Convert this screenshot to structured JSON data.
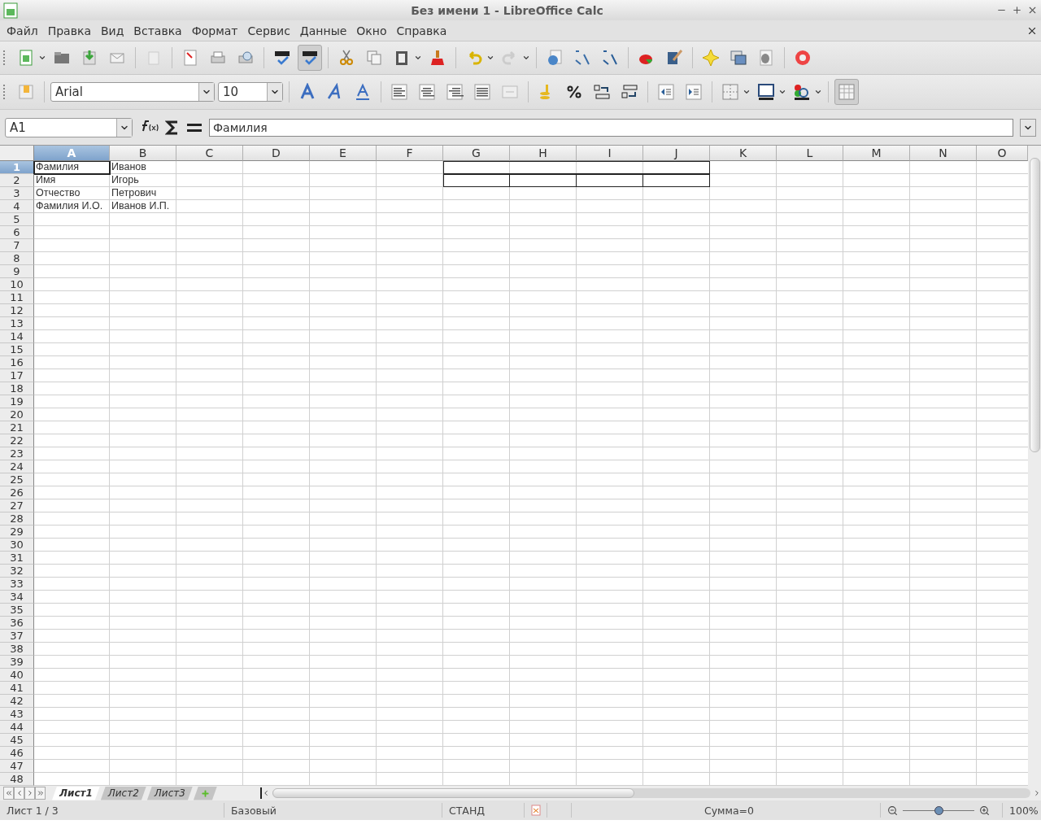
{
  "window": {
    "title": "Без имени 1 - LibreOffice Calc"
  },
  "menu": [
    {
      "label": "Файл"
    },
    {
      "label": "Правка"
    },
    {
      "label": "Вид"
    },
    {
      "label": "Вставка"
    },
    {
      "label": "Формат"
    },
    {
      "label": "Сервис"
    },
    {
      "label": "Данные"
    },
    {
      "label": "Окно"
    },
    {
      "label": "Справка"
    }
  ],
  "formatting": {
    "font_name": "Arial",
    "font_size": "10"
  },
  "formula_bar": {
    "name_box": "A1",
    "formula": "Фамилия"
  },
  "columns": [
    {
      "label": "A",
      "selected": true
    },
    {
      "label": "B",
      "selected": false
    },
    {
      "label": "C",
      "selected": false
    },
    {
      "label": "D",
      "selected": false
    },
    {
      "label": "E",
      "selected": false
    },
    {
      "label": "F",
      "selected": false
    },
    {
      "label": "G",
      "selected": false
    },
    {
      "label": "H",
      "selected": false
    },
    {
      "label": "I",
      "selected": false
    },
    {
      "label": "J",
      "selected": false
    },
    {
      "label": "K",
      "selected": false
    },
    {
      "label": "L",
      "selected": false
    },
    {
      "label": "M",
      "selected": false
    },
    {
      "label": "N",
      "selected": false
    },
    {
      "label": "O",
      "selected": false
    }
  ],
  "rows": [
    {
      "header": "1",
      "selected": true,
      "cells": [
        {
          "text": "Фамилия",
          "selected": true
        },
        {
          "text": "Иванов",
          "selected": false
        },
        {},
        {},
        {},
        {},
        {
          "kind": "outer-border"
        },
        {
          "kind": "outer-border"
        },
        {
          "kind": "outer-border"
        },
        {
          "kind": "outer-border"
        }
      ]
    },
    {
      "header": "2",
      "selected": false,
      "cells": [
        {
          "text": "Имя",
          "selected": false
        },
        {
          "text": "Игорь",
          "selected": false
        },
        {},
        {},
        {},
        {},
        {
          "kind": "box-border"
        },
        {
          "kind": "box-border"
        },
        {
          "kind": "box-border"
        },
        {
          "kind": "box-border"
        }
      ]
    },
    {
      "header": "3",
      "selected": false,
      "cells": [
        {
          "text": "Отчество",
          "selected": false
        },
        {
          "text": "Петрович",
          "selected": false
        }
      ]
    },
    {
      "header": "4",
      "selected": false,
      "cells": [
        {
          "text": "Фамилия И.О.",
          "selected": false
        },
        {
          "text": "Иванов И.П.",
          "selected": false
        }
      ]
    },
    {
      "header": "5",
      "selected": false
    },
    {
      "header": "6",
      "selected": false
    },
    {
      "header": "7",
      "selected": false
    },
    {
      "header": "8",
      "selected": false
    },
    {
      "header": "9",
      "selected": false
    },
    {
      "header": "10",
      "selected": false
    },
    {
      "header": "11",
      "selected": false
    },
    {
      "header": "12",
      "selected": false
    },
    {
      "header": "13",
      "selected": false
    },
    {
      "header": "14",
      "selected": false
    },
    {
      "header": "15",
      "selected": false
    },
    {
      "header": "16",
      "selected": false
    },
    {
      "header": "17",
      "selected": false
    },
    {
      "header": "18",
      "selected": false
    },
    {
      "header": "19",
      "selected": false
    },
    {
      "header": "20",
      "selected": false
    },
    {
      "header": "21",
      "selected": false
    },
    {
      "header": "22",
      "selected": false
    },
    {
      "header": "23",
      "selected": false
    },
    {
      "header": "24",
      "selected": false
    },
    {
      "header": "25",
      "selected": false
    },
    {
      "header": "26",
      "selected": false
    },
    {
      "header": "27",
      "selected": false
    },
    {
      "header": "28",
      "selected": false
    },
    {
      "header": "29",
      "selected": false
    },
    {
      "header": "30",
      "selected": false
    },
    {
      "header": "31",
      "selected": false
    },
    {
      "header": "32",
      "selected": false
    },
    {
      "header": "33",
      "selected": false
    },
    {
      "header": "34",
      "selected": false
    },
    {
      "header": "35",
      "selected": false
    },
    {
      "header": "36",
      "selected": false
    },
    {
      "header": "37",
      "selected": false
    },
    {
      "header": "38",
      "selected": false
    },
    {
      "header": "39",
      "selected": false
    },
    {
      "header": "40",
      "selected": false
    },
    {
      "header": "41",
      "selected": false
    },
    {
      "header": "42",
      "selected": false
    },
    {
      "header": "43",
      "selected": false
    },
    {
      "header": "44",
      "selected": false
    },
    {
      "header": "45",
      "selected": false
    },
    {
      "header": "46",
      "selected": false
    },
    {
      "header": "47",
      "selected": false
    },
    {
      "header": "48",
      "selected": false
    }
  ],
  "sheet_tabs": [
    {
      "label": "Лист1",
      "selected": true
    },
    {
      "label": "Лист2",
      "selected": false
    },
    {
      "label": "Лист3",
      "selected": false
    }
  ],
  "status_bar": {
    "sheet": "Лист 1 / 3",
    "page_style": "Базовый",
    "mode": "СТАНД",
    "sum": "Сумма=0",
    "zoom": {
      "level": 0.5
    },
    "zoom_percent": "100%"
  }
}
